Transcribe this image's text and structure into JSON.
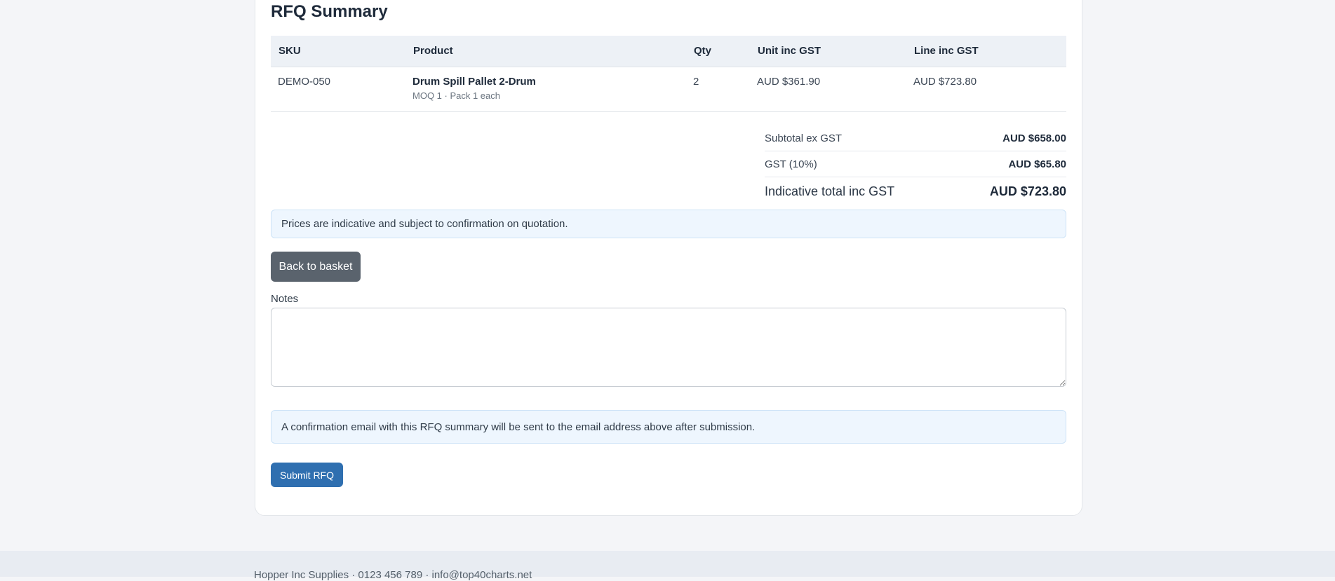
{
  "summary": {
    "title": "RFQ Summary",
    "columns": {
      "sku": "SKU",
      "product": "Product",
      "qty": "Qty",
      "unit": "Unit inc GST",
      "line": "Line inc GST"
    },
    "rows": [
      {
        "sku": "DEMO-050",
        "product": "Drum Spill Pallet 2-Drum",
        "meta": "MOQ 1 · Pack 1 each",
        "qty": "2",
        "unit": "AUD $361.90",
        "line": "AUD $723.80"
      }
    ],
    "totals": {
      "subtotal_label": "Subtotal ex GST",
      "subtotal_value": "AUD $658.00",
      "gst_label": "GST (10%)",
      "gst_value": "AUD $65.80",
      "total_label": "Indicative total inc GST",
      "total_value": "AUD $723.80"
    }
  },
  "notice_prices": "Prices are indicative and subject to confirmation on quotation.",
  "back_button": "Back to basket",
  "notes": {
    "label": "Notes",
    "value": "",
    "placeholder": ""
  },
  "notice_email": "A confirmation email with this RFQ summary will be sent to the email address above after submission.",
  "submit_button": "Submit RFQ",
  "footer": {
    "text": "Hopper Inc Supplies · 0123 456 789 · info@top40charts.net"
  },
  "colors": {
    "primary": "#2f6fb0",
    "secondary": "#5a636d",
    "info_bg": "#eef6fe"
  }
}
